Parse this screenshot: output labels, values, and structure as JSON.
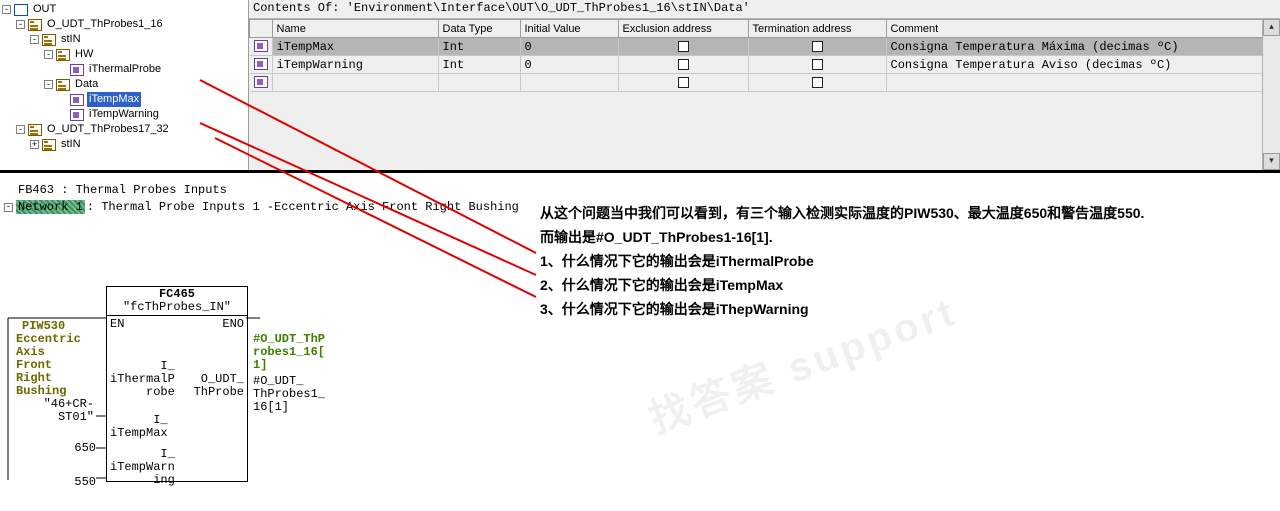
{
  "pathbar": "Contents Of: 'Environment\\Interface\\OUT\\O_UDT_ThProbes1_16\\stIN\\Data'",
  "tree": {
    "n0": {
      "exp": "-",
      "label": "OUT"
    },
    "n1": {
      "exp": "-",
      "label": "O_UDT_ThProbes1_16"
    },
    "n2": {
      "exp": "-",
      "label": "stIN"
    },
    "n3": {
      "exp": "-",
      "label": "HW"
    },
    "n4": {
      "exp": "",
      "label": "iThermalProbe"
    },
    "n5": {
      "exp": "-",
      "label": "Data"
    },
    "n6": {
      "exp": "",
      "label": "iTempMax"
    },
    "n7": {
      "exp": "",
      "label": "iTempWarning"
    },
    "n8": {
      "exp": "-",
      "label": "O_UDT_ThProbes17_32"
    },
    "n9": {
      "exp": "+",
      "label": "stIN"
    }
  },
  "grid": {
    "headers": {
      "c0": "",
      "c1": "Name",
      "c2": "Data Type",
      "c3": "Initial Value",
      "c4": "Exclusion address",
      "c5": "Termination address",
      "c6": "Comment"
    },
    "rows": [
      {
        "name": "iTempMax",
        "type": "Int",
        "init": "0",
        "comment": "Consigna Temperatura Máxima (decimas ºC)"
      },
      {
        "name": "iTempWarning",
        "type": "Int",
        "init": "0",
        "comment": "Consigna Temperatura Aviso (decimas ºC)"
      }
    ]
  },
  "fb": {
    "title": "FB463 : Thermal Probes Inputs",
    "network": "Network 1",
    "netdesc": ": Thermal Probe Inputs 1 -Eccentric Axis Front Right Bushing",
    "box": {
      "fc": "FC465",
      "fcname": "\"fcThProbes_IN\"",
      "en": "EN",
      "eno": "ENO"
    },
    "lpins": {
      "p1": "I_\niThermalP\nrobe",
      "p2": "I_\niTempMax",
      "p3": "I_\niTempWarn\ning"
    },
    "rpins": {
      "p1": "O_UDT_\nThProbe"
    },
    "lext": {
      "e1": "PIW530",
      "e1b": "Eccentric\nAxis\nFront\nRight\nBushing",
      "e1c": "\"46+CR-\nST01\"",
      "e2": "650",
      "e3": "550"
    },
    "rext": {
      "e1": "#O_UDT_ThP\nrobes1_16[\n1]",
      "e1b": "#O_UDT_\nThProbes1_\n16[1]"
    }
  },
  "anno": {
    "l1": "从这个问题当中我们可以看到，有三个输入检测实际温度的PIW530、最大温度650和警告温度550.",
    "l2": "而输出是#O_UDT_ThProbes1-16[1].",
    "l3": "1、什么情况下它的输出会是iThermalProbe",
    "l4": "2、什么情况下它的输出会是iTempMax",
    "l5": "3、什么情况下它的输出会是iThepWarning"
  }
}
